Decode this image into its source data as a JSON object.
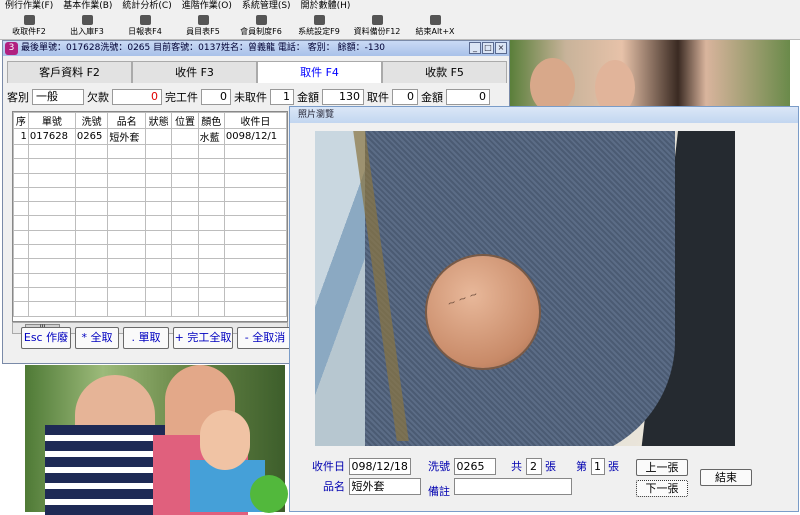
{
  "menu": [
    "例行作業(F)",
    "基本作業(B)",
    "統計分析(C)",
    "進階作業(O)",
    "系統管理(S)",
    "開於數體(H)"
  ],
  "toolbar": [
    "收取件F2",
    "出入庫F3",
    "日報表F4",
    "員目表F5",
    "會員制度F6",
    "系統設定F9",
    "資料備份F12",
    "結束Alt+X"
  ],
  "main": {
    "title": "最後單號：017628洗號：0265 目前客號：0137姓名：曾義龍 電話： 客別： 餘額：-130",
    "tabs": [
      "客戶資料 F2",
      "收件 F3",
      "取件 F4",
      "收款 F5"
    ],
    "active_tab": "取件 F4",
    "fields": {
      "kebie_label": "客別",
      "kebie_value": "一般",
      "qiankuan_label": "欠款",
      "qiankuan_value": "0",
      "wangong_label": "完工件",
      "wangong_value": "0",
      "weiqu_label": "未取件",
      "weiqu_value": "1",
      "jine_label": "金額",
      "jine_value": "130",
      "quijian_label": "取件",
      "quijian_value": "0",
      "jine2_label": "金額",
      "jine2_value": "0"
    },
    "grid": {
      "headers": [
        "序",
        "單號",
        "洗號",
        "品名",
        "狀態",
        "位置",
        "顏色",
        "收件日"
      ],
      "rows": [
        [
          "1",
          "017628",
          "0265",
          "短外套",
          "",
          "",
          "水藍",
          "0098/12/1"
        ]
      ],
      "empty_rows": 12
    },
    "buttons": [
      "Esc 作廢",
      "* 全取",
      ". 單取",
      "+ 完工全取",
      "- 全取消"
    ]
  },
  "preview": {
    "title": "照片瀏覽",
    "shoujianri_label": "收件日",
    "shoujianri_value": "098/12/18",
    "xihao_label": "洗號",
    "xihao_value": "0265",
    "gong_label": "共",
    "gong_value": "2",
    "zhang1": "張",
    "di_label": "第",
    "di_value": "1",
    "zhang2": "張",
    "prev_label": "上一張",
    "next_label": "下一張",
    "end_label": "結束",
    "pinming_label": "品名",
    "pinming_value": "短外套",
    "beizhu_label": "備註",
    "beizhu_value": ""
  }
}
